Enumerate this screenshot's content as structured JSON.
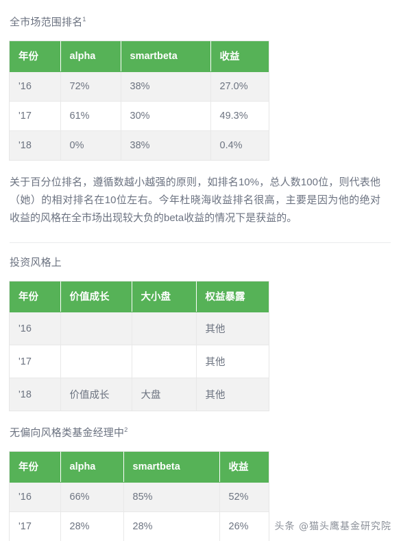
{
  "sections": [
    {
      "heading": "全市场范围排名",
      "heading_sup": "1",
      "table": {
        "columns": [
          "年份",
          "alpha",
          "smartbeta",
          "收益"
        ],
        "rows": [
          [
            "'16",
            "72%",
            "38%",
            "27.0%"
          ],
          [
            "'17",
            "61%",
            "30%",
            "49.3%"
          ],
          [
            "'18",
            "0%",
            "38%",
            "0.4%"
          ]
        ]
      }
    },
    {
      "heading": "投资风格上",
      "heading_sup": "",
      "table": {
        "columns": [
          "年份",
          "价值成长",
          "大小盘",
          "权益暴露"
        ],
        "rows": [
          [
            "'16",
            "",
            "",
            "其他"
          ],
          [
            "'17",
            "",
            "",
            "其他"
          ],
          [
            "'18",
            "价值成长",
            "大盘",
            "其他"
          ]
        ]
      }
    },
    {
      "heading": "无偏向风格类基金经理中",
      "heading_sup": "2",
      "table": {
        "columns": [
          "年份",
          "alpha",
          "smartbeta",
          "收益"
        ],
        "rows": [
          [
            "'16",
            "66%",
            "85%",
            "52%"
          ],
          [
            "'17",
            "28%",
            "28%",
            "26%"
          ]
        ]
      }
    }
  ],
  "paragraph": "关于百分位排名，遵循数越小越强的原则，如排名10%，总人数100位，则代表他（她）的相对排名在10位左右。今年杜晓海收益排名很高，主要是因为他的绝对收益的风格在全市场出现较大负的beta收益的情况下是获益的。",
  "watermark": "头条 @猫头鹰基金研究院",
  "colors": {
    "header_green": "#56b257",
    "row_stripe": "#f2f2f2",
    "text": "#6b7280",
    "divider": "#e9eaec"
  }
}
